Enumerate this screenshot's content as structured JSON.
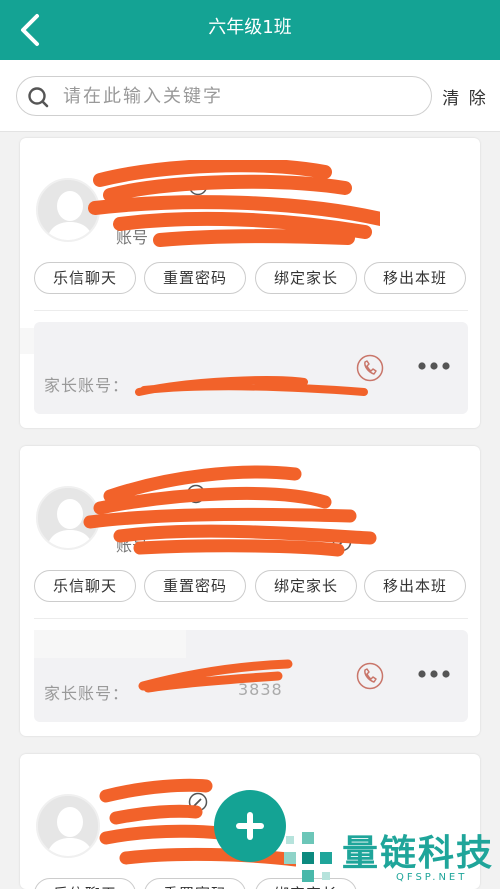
{
  "header": {
    "title": "六年级1班"
  },
  "search": {
    "placeholder": "请在此输入关键字",
    "value": "",
    "clear_label": "清 除"
  },
  "students": [
    {
      "account_label": "账号",
      "actions": [
        "乐信聊天",
        "重置密码",
        "绑定家长",
        "移出本班"
      ],
      "parent_account_label": "家长账号："
    },
    {
      "account_label": "账号",
      "actions": [
        "乐信聊天",
        "重置密码",
        "绑定家长",
        "移出本班"
      ],
      "parent_account_label": "家长账号：",
      "parent_account_value_partial": "3838"
    },
    {
      "actions": [
        "乐信聊天",
        "重置密码",
        "绑定家长"
      ]
    }
  ],
  "watermark": {
    "text": "量链科技",
    "sub": "QFSP.NET"
  },
  "colors": {
    "accent": "#14a394",
    "redaction": "#f2622a",
    "phone_icon": "#c9766a"
  },
  "icons": {
    "back": "chevron-left-icon",
    "search": "search-icon",
    "edit": "edit-icon",
    "phone": "phone-icon",
    "more": "more-icon",
    "add": "plus-icon"
  }
}
